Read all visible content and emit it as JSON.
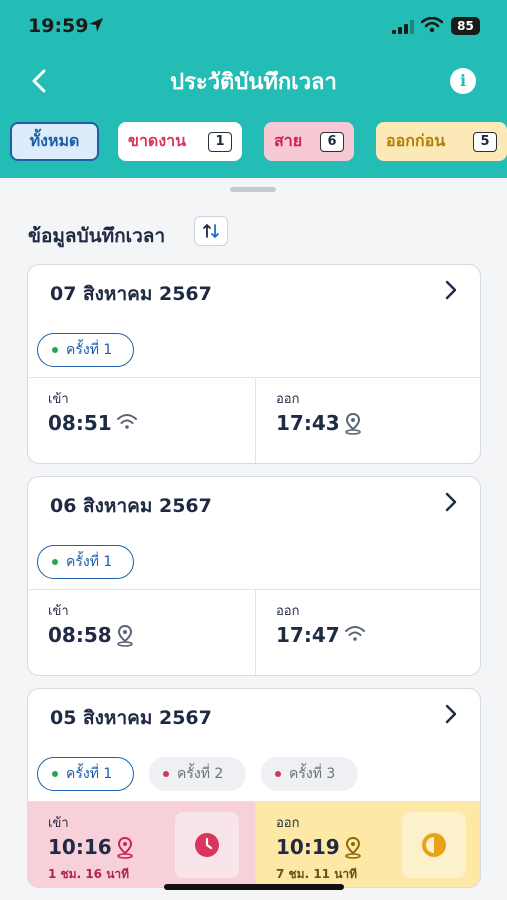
{
  "status_bar": {
    "time": "19:59",
    "battery": "85"
  },
  "nav": {
    "title": "ประวัติบันทึกเวลา"
  },
  "filters": [
    {
      "label": "ทั้งหมด"
    },
    {
      "label": "ขาดงาน",
      "count": "1"
    },
    {
      "label": "สาย",
      "count": "6"
    },
    {
      "label": "ออกก่อน",
      "count": "5"
    }
  ],
  "section": {
    "title": "ข้อมูลบันทึกเวลา"
  },
  "records": [
    {
      "date": "07 สิงหาคม 2567",
      "rounds": [
        "ครั้งที่ 1"
      ],
      "in": {
        "label": "เข้า",
        "time": "08:51",
        "method": "wifi-icon"
      },
      "out": {
        "label": "ออก",
        "time": "17:43",
        "method": "location-pin-icon"
      }
    },
    {
      "date": "06 สิงหาคม 2567",
      "rounds": [
        "ครั้งที่ 1"
      ],
      "in": {
        "label": "เข้า",
        "time": "08:58",
        "method": "location-pin-icon"
      },
      "out": {
        "label": "ออก",
        "time": "17:47",
        "method": "wifi-icon"
      }
    },
    {
      "date": "05 สิงหาคม 2567",
      "rounds": [
        "ครั้งที่ 1",
        "ครั้งที่ 2",
        "ครั้งที่ 3"
      ],
      "in": {
        "label": "เข้า",
        "time": "10:16",
        "method": "location-pin-icon",
        "note": "1 ชม. 16 นาที",
        "status_color": "#d8365f"
      },
      "out": {
        "label": "ออก",
        "time": "10:19",
        "method": "location-pin-icon",
        "note": "7 ชม. 11 นาที",
        "status_color": "#e8a21a"
      }
    }
  ]
}
